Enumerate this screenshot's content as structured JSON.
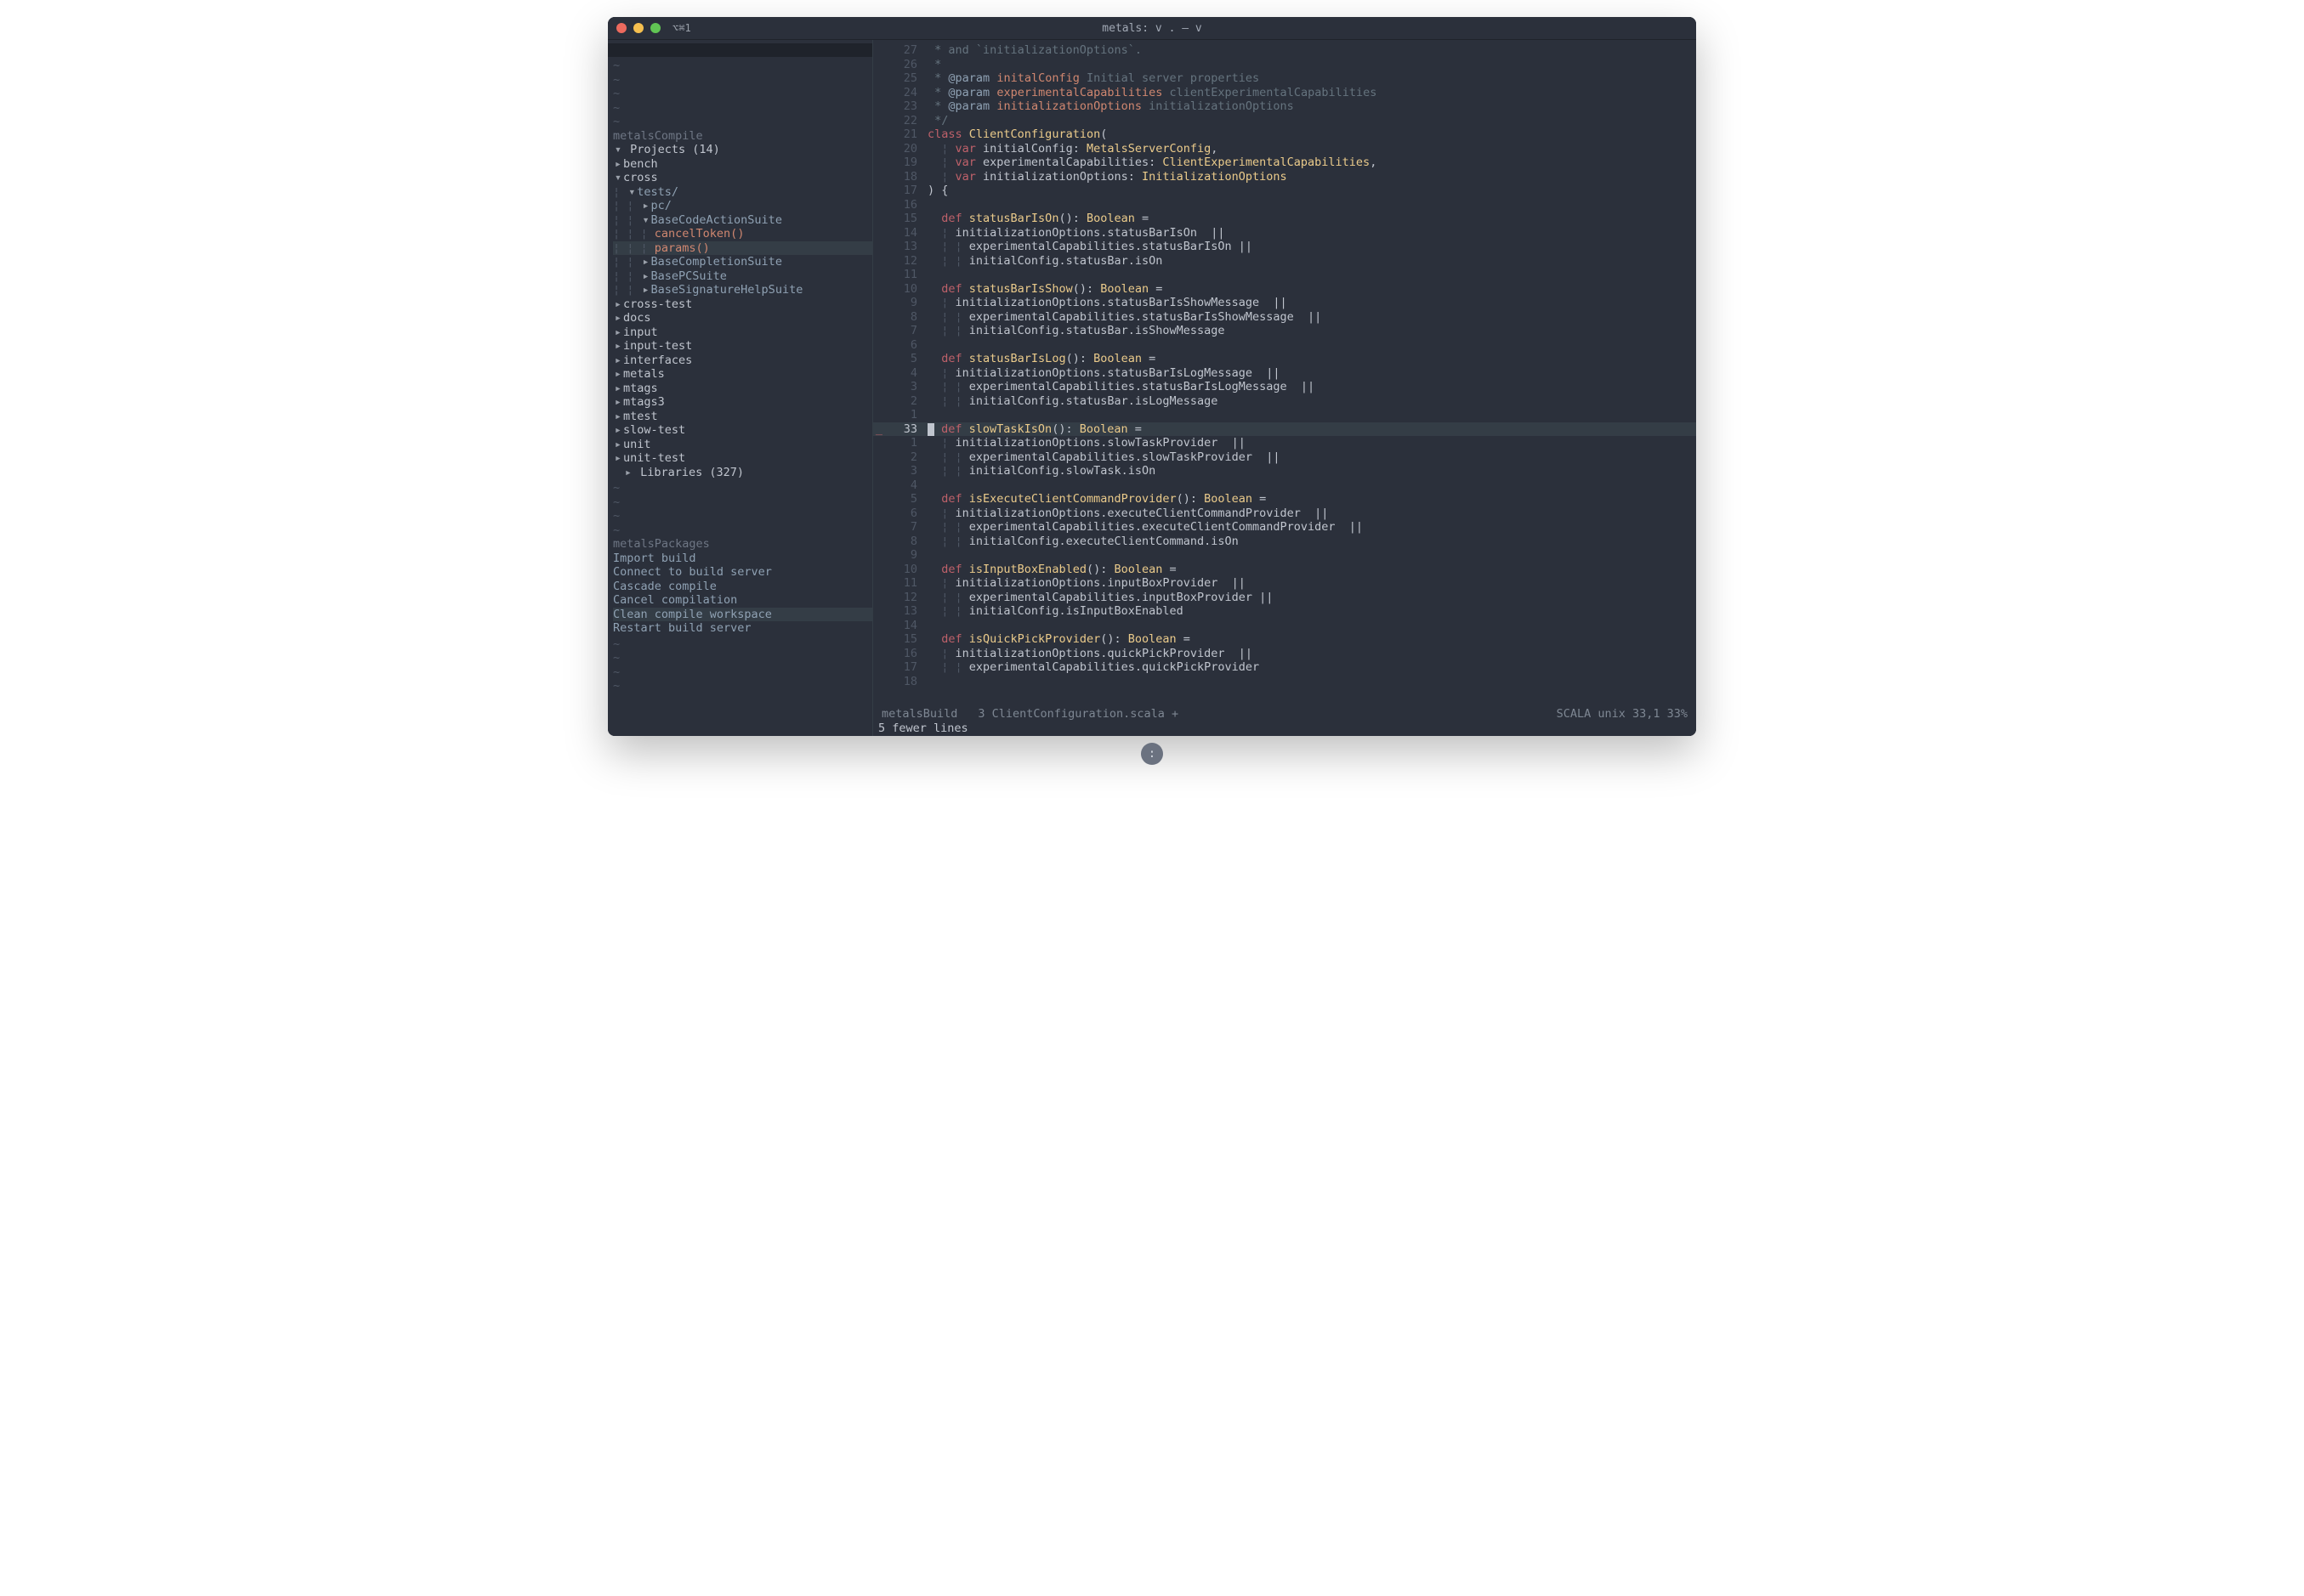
{
  "window": {
    "shortcut": "⌥⌘1",
    "title": "metals: v . — v"
  },
  "sidebar": {
    "section1": "metalsCompile",
    "projectsLabel": "Projects (14)",
    "tree": [
      {
        "indent": 1,
        "arrow": "▸",
        "label": "bench",
        "cls": ""
      },
      {
        "indent": 1,
        "arrow": "▾",
        "label": "cross",
        "cls": ""
      },
      {
        "indent": 2,
        "arrow": "▾",
        "label": "tests/",
        "cls": "blue",
        "guide": "¦ "
      },
      {
        "indent": 3,
        "arrow": "▸",
        "label": "pc/",
        "cls": "blue",
        "guide": "¦ ¦ "
      },
      {
        "indent": 3,
        "arrow": "▾",
        "label": "BaseCodeActionSuite",
        "cls": "blue",
        "guide": "¦ ¦ "
      },
      {
        "indent": 4,
        "arrow": "",
        "label": "cancelToken()",
        "cls": "coral",
        "guide": "¦ ¦ ¦ "
      },
      {
        "indent": 4,
        "arrow": "",
        "label": "params()",
        "cls": "coral hl",
        "guide": "¦ ¦ ¦ "
      },
      {
        "indent": 3,
        "arrow": "▸",
        "label": "BaseCompletionSuite",
        "cls": "blue",
        "guide": "¦ ¦ "
      },
      {
        "indent": 3,
        "arrow": "▸",
        "label": "BasePCSuite",
        "cls": "blue",
        "guide": "¦ ¦ "
      },
      {
        "indent": 3,
        "arrow": "▸",
        "label": "BaseSignatureHelpSuite",
        "cls": "blue",
        "guide": "¦ ¦ "
      },
      {
        "indent": 1,
        "arrow": "▸",
        "label": "cross-test",
        "cls": ""
      },
      {
        "indent": 1,
        "arrow": "▸",
        "label": "docs",
        "cls": ""
      },
      {
        "indent": 1,
        "arrow": "▸",
        "label": "input",
        "cls": ""
      },
      {
        "indent": 1,
        "arrow": "▸",
        "label": "input-test",
        "cls": ""
      },
      {
        "indent": 1,
        "arrow": "▸",
        "label": "interfaces",
        "cls": ""
      },
      {
        "indent": 1,
        "arrow": "▸",
        "label": "metals",
        "cls": ""
      },
      {
        "indent": 1,
        "arrow": "▸",
        "label": "mtags",
        "cls": ""
      },
      {
        "indent": 1,
        "arrow": "▸",
        "label": "mtags3",
        "cls": ""
      },
      {
        "indent": 1,
        "arrow": "▸",
        "label": "mtest",
        "cls": ""
      },
      {
        "indent": 1,
        "arrow": "▸",
        "label": "slow-test",
        "cls": ""
      },
      {
        "indent": 1,
        "arrow": "▸",
        "label": "unit",
        "cls": ""
      },
      {
        "indent": 1,
        "arrow": "▸",
        "label": "unit-test",
        "cls": ""
      }
    ],
    "librariesLabel": "Libraries (327)",
    "section2": "metalsPackages",
    "commands": [
      {
        "label": "Import build",
        "hl": false
      },
      {
        "label": "Connect to build server",
        "hl": false
      },
      {
        "label": "Cascade compile",
        "hl": false
      },
      {
        "label": "Cancel compilation",
        "hl": false
      },
      {
        "label": "Clean compile workspace",
        "hl": true
      },
      {
        "label": "Restart build server",
        "hl": false
      }
    ]
  },
  "editor": {
    "lines": [
      {
        "n": "27",
        "tokens": [
          {
            "t": " * and `initializationOptions`.",
            "c": "c-comment"
          }
        ]
      },
      {
        "n": "26",
        "tokens": [
          {
            "t": " *",
            "c": "c-comment"
          }
        ]
      },
      {
        "n": "25",
        "tokens": [
          {
            "t": " * ",
            "c": "c-comment"
          },
          {
            "t": "@param",
            "c": "c-ann"
          },
          {
            "t": " ",
            "c": ""
          },
          {
            "t": "initalConfig",
            "c": "c-param"
          },
          {
            "t": " Initial server properties",
            "c": "c-comment"
          }
        ]
      },
      {
        "n": "24",
        "tokens": [
          {
            "t": " * ",
            "c": "c-comment"
          },
          {
            "t": "@param",
            "c": "c-ann"
          },
          {
            "t": " ",
            "c": ""
          },
          {
            "t": "experimentalCapabilities",
            "c": "c-param"
          },
          {
            "t": " clientExperimentalCapabilities",
            "c": "c-comment"
          }
        ]
      },
      {
        "n": "23",
        "tokens": [
          {
            "t": " * ",
            "c": "c-comment"
          },
          {
            "t": "@param",
            "c": "c-ann"
          },
          {
            "t": " ",
            "c": ""
          },
          {
            "t": "initializationOptions",
            "c": "c-param"
          },
          {
            "t": " initializationOptions",
            "c": "c-comment"
          }
        ]
      },
      {
        "n": "22",
        "tokens": [
          {
            "t": " */",
            "c": "c-comment"
          }
        ]
      },
      {
        "n": "21",
        "tokens": [
          {
            "t": "class ",
            "c": "c-keyword"
          },
          {
            "t": "ClientConfiguration",
            "c": "c-type"
          },
          {
            "t": "(",
            "c": "c-ident"
          }
        ]
      },
      {
        "n": "20",
        "tokens": [
          {
            "t": "  ¦ ",
            "c": "c-guide"
          },
          {
            "t": "var ",
            "c": "c-var"
          },
          {
            "t": "initialConfig: ",
            "c": "c-ident"
          },
          {
            "t": "MetalsServerConfig",
            "c": "c-type"
          },
          {
            "t": ",",
            "c": "c-ident"
          }
        ]
      },
      {
        "n": "19",
        "tokens": [
          {
            "t": "  ¦ ",
            "c": "c-guide"
          },
          {
            "t": "var ",
            "c": "c-var"
          },
          {
            "t": "experimentalCapabilities: ",
            "c": "c-ident"
          },
          {
            "t": "ClientExperimentalCapabilities",
            "c": "c-type"
          },
          {
            "t": ",",
            "c": "c-ident"
          }
        ]
      },
      {
        "n": "18",
        "tokens": [
          {
            "t": "  ¦ ",
            "c": "c-guide"
          },
          {
            "t": "var ",
            "c": "c-var"
          },
          {
            "t": "initializationOptions: ",
            "c": "c-ident"
          },
          {
            "t": "InitializationOptions",
            "c": "c-type"
          }
        ]
      },
      {
        "n": "17",
        "tokens": [
          {
            "t": ") {",
            "c": "c-ident"
          }
        ]
      },
      {
        "n": "16",
        "tokens": [
          {
            "t": "",
            "c": ""
          }
        ]
      },
      {
        "n": "15",
        "tokens": [
          {
            "t": "  ",
            "c": ""
          },
          {
            "t": "def ",
            "c": "c-def"
          },
          {
            "t": "statusBarIsOn",
            "c": "c-type"
          },
          {
            "t": "(): ",
            "c": "c-ident"
          },
          {
            "t": "Boolean",
            "c": "c-type"
          },
          {
            "t": " =",
            "c": "c-ident"
          }
        ]
      },
      {
        "n": "14",
        "tokens": [
          {
            "t": "  ¦ ",
            "c": "c-guide"
          },
          {
            "t": "initializationOptions.statusBarIsOn  ||",
            "c": "c-ident"
          }
        ]
      },
      {
        "n": "13",
        "tokens": [
          {
            "t": "  ¦ ¦ ",
            "c": "c-guide"
          },
          {
            "t": "experimentalCapabilities.statusBarIsOn ||",
            "c": "c-ident"
          }
        ]
      },
      {
        "n": "12",
        "tokens": [
          {
            "t": "  ¦ ¦ ",
            "c": "c-guide"
          },
          {
            "t": "initialConfig.statusBar.isOn",
            "c": "c-ident"
          }
        ]
      },
      {
        "n": "11",
        "tokens": [
          {
            "t": "",
            "c": ""
          }
        ]
      },
      {
        "n": "10",
        "tokens": [
          {
            "t": "  ",
            "c": ""
          },
          {
            "t": "def ",
            "c": "c-def"
          },
          {
            "t": "statusBarIsShow",
            "c": "c-type"
          },
          {
            "t": "(): ",
            "c": "c-ident"
          },
          {
            "t": "Boolean",
            "c": "c-type"
          },
          {
            "t": " =",
            "c": "c-ident"
          }
        ]
      },
      {
        "n": "9",
        "tokens": [
          {
            "t": "  ¦ ",
            "c": "c-guide"
          },
          {
            "t": "initializationOptions.statusBarIsShowMessage  ||",
            "c": "c-ident"
          }
        ]
      },
      {
        "n": "8",
        "tokens": [
          {
            "t": "  ¦ ¦ ",
            "c": "c-guide"
          },
          {
            "t": "experimentalCapabilities.statusBarIsShowMessage  ||",
            "c": "c-ident"
          }
        ]
      },
      {
        "n": "7",
        "tokens": [
          {
            "t": "  ¦ ¦ ",
            "c": "c-guide"
          },
          {
            "t": "initialConfig.statusBar.isShowMessage",
            "c": "c-ident"
          }
        ]
      },
      {
        "n": "6",
        "tokens": [
          {
            "t": "",
            "c": ""
          }
        ]
      },
      {
        "n": "5",
        "tokens": [
          {
            "t": "  ",
            "c": ""
          },
          {
            "t": "def ",
            "c": "c-def"
          },
          {
            "t": "statusBarIsLog",
            "c": "c-type"
          },
          {
            "t": "(): ",
            "c": "c-ident"
          },
          {
            "t": "Boolean",
            "c": "c-type"
          },
          {
            "t": " =",
            "c": "c-ident"
          }
        ]
      },
      {
        "n": "4",
        "tokens": [
          {
            "t": "  ¦ ",
            "c": "c-guide"
          },
          {
            "t": "initializationOptions.statusBarIsLogMessage  ||",
            "c": "c-ident"
          }
        ]
      },
      {
        "n": "3",
        "tokens": [
          {
            "t": "  ¦ ¦ ",
            "c": "c-guide"
          },
          {
            "t": "experimentalCapabilities.statusBarIsLogMessage  ||",
            "c": "c-ident"
          }
        ]
      },
      {
        "n": "2",
        "tokens": [
          {
            "t": "  ¦ ¦ ",
            "c": "c-guide"
          },
          {
            "t": "initialConfig.statusBar.isLogMessage",
            "c": "c-ident"
          }
        ]
      },
      {
        "n": "1",
        "tokens": [
          {
            "t": "",
            "c": ""
          }
        ]
      },
      {
        "n": "33",
        "current": true,
        "sign": "_",
        "tokens": [
          {
            "cursor": true
          },
          {
            "t": " ",
            "c": ""
          },
          {
            "t": "def ",
            "c": "c-def"
          },
          {
            "t": "slowTaskIsOn",
            "c": "c-type"
          },
          {
            "t": "(): ",
            "c": "c-ident"
          },
          {
            "t": "Boolean",
            "c": "c-type"
          },
          {
            "t": " =",
            "c": "c-ident"
          }
        ]
      },
      {
        "n": "1",
        "tokens": [
          {
            "t": "  ¦ ",
            "c": "c-guide"
          },
          {
            "t": "initializationOptions.slowTaskProvider  ||",
            "c": "c-ident"
          }
        ]
      },
      {
        "n": "2",
        "tokens": [
          {
            "t": "  ¦ ¦ ",
            "c": "c-guide"
          },
          {
            "t": "experimentalCapabilities.slowTaskProvider  ||",
            "c": "c-ident"
          }
        ]
      },
      {
        "n": "3",
        "tokens": [
          {
            "t": "  ¦ ¦ ",
            "c": "c-guide"
          },
          {
            "t": "initialConfig.slowTask.isOn",
            "c": "c-ident"
          }
        ]
      },
      {
        "n": "4",
        "tokens": [
          {
            "t": "",
            "c": ""
          }
        ]
      },
      {
        "n": "5",
        "tokens": [
          {
            "t": "  ",
            "c": ""
          },
          {
            "t": "def ",
            "c": "c-def"
          },
          {
            "t": "isExecuteClientCommandProvider",
            "c": "c-type"
          },
          {
            "t": "(): ",
            "c": "c-ident"
          },
          {
            "t": "Boolean",
            "c": "c-type"
          },
          {
            "t": " =",
            "c": "c-ident"
          }
        ]
      },
      {
        "n": "6",
        "tokens": [
          {
            "t": "  ¦ ",
            "c": "c-guide"
          },
          {
            "t": "initializationOptions.executeClientCommandProvider  ||",
            "c": "c-ident"
          }
        ]
      },
      {
        "n": "7",
        "tokens": [
          {
            "t": "  ¦ ¦ ",
            "c": "c-guide"
          },
          {
            "t": "experimentalCapabilities.executeClientCommandProvider  ||",
            "c": "c-ident"
          }
        ]
      },
      {
        "n": "8",
        "tokens": [
          {
            "t": "  ¦ ¦ ",
            "c": "c-guide"
          },
          {
            "t": "initialConfig.executeClientCommand.isOn",
            "c": "c-ident"
          }
        ]
      },
      {
        "n": "9",
        "tokens": [
          {
            "t": "",
            "c": ""
          }
        ]
      },
      {
        "n": "10",
        "tokens": [
          {
            "t": "  ",
            "c": ""
          },
          {
            "t": "def ",
            "c": "c-def"
          },
          {
            "t": "isInputBoxEnabled",
            "c": "c-type"
          },
          {
            "t": "(): ",
            "c": "c-ident"
          },
          {
            "t": "Boolean",
            "c": "c-type"
          },
          {
            "t": " =",
            "c": "c-ident"
          }
        ]
      },
      {
        "n": "11",
        "tokens": [
          {
            "t": "  ¦ ",
            "c": "c-guide"
          },
          {
            "t": "initializationOptions.inputBoxProvider  ||",
            "c": "c-ident"
          }
        ]
      },
      {
        "n": "12",
        "tokens": [
          {
            "t": "  ¦ ¦ ",
            "c": "c-guide"
          },
          {
            "t": "experimentalCapabilities.inputBoxProvider ||",
            "c": "c-ident"
          }
        ]
      },
      {
        "n": "13",
        "tokens": [
          {
            "t": "  ¦ ¦ ",
            "c": "c-guide"
          },
          {
            "t": "initialConfig.isInputBoxEnabled",
            "c": "c-ident"
          }
        ]
      },
      {
        "n": "14",
        "tokens": [
          {
            "t": "",
            "c": ""
          }
        ]
      },
      {
        "n": "15",
        "tokens": [
          {
            "t": "  ",
            "c": ""
          },
          {
            "t": "def ",
            "c": "c-def"
          },
          {
            "t": "isQuickPickProvider",
            "c": "c-type"
          },
          {
            "t": "(): ",
            "c": "c-ident"
          },
          {
            "t": "Boolean",
            "c": "c-type"
          },
          {
            "t": " =",
            "c": "c-ident"
          }
        ]
      },
      {
        "n": "16",
        "tokens": [
          {
            "t": "  ¦ ",
            "c": "c-guide"
          },
          {
            "t": "initializationOptions.quickPickProvider  ||",
            "c": "c-ident"
          }
        ]
      },
      {
        "n": "17",
        "tokens": [
          {
            "t": "  ¦ ¦ ",
            "c": "c-guide"
          },
          {
            "t": "experimentalCapabilities.quickPickProvider",
            "c": "c-ident"
          }
        ]
      },
      {
        "n": "18",
        "tokens": [
          {
            "t": "",
            "c": ""
          }
        ]
      }
    ]
  },
  "status": {
    "leftA": "metalsBuild",
    "leftB": "3 ClientConfiguration.scala +",
    "right": "SCALA unix 33,1 33%",
    "msg": "5 fewer lines"
  },
  "floatBtn": ":"
}
